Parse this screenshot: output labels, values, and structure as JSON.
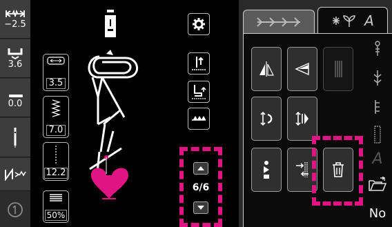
{
  "left_column": {
    "stitch_width": "−2.5",
    "stitch_length": "3.6",
    "foot_pressure": "0.0"
  },
  "stitch_settings": {
    "width_value": "3.5",
    "length_value": "7.0",
    "density_value": "12.2",
    "balance_value": "50%"
  },
  "page": {
    "indicator": "6/6"
  },
  "tabs": {
    "tab_a_icon": "arrows-icon",
    "tab_b_icon": "flower-text-icon",
    "tab_b_label": "A"
  },
  "side": {
    "letter_a": "A",
    "no_label": "No"
  },
  "colors": {
    "accent": "#e01583",
    "panel": "#2a2a2a"
  }
}
